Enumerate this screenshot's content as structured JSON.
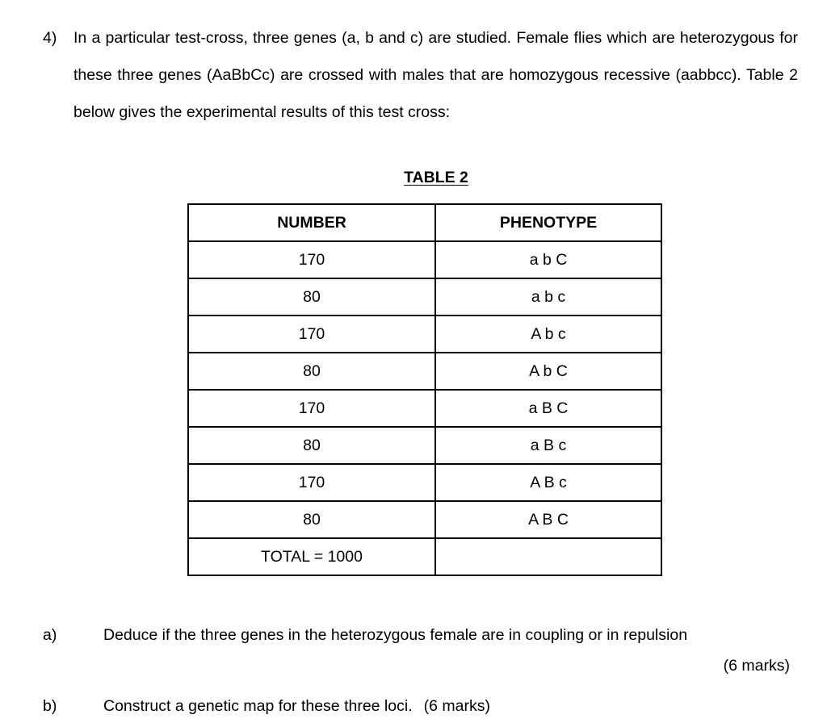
{
  "question": {
    "number": "4)",
    "text": "In a particular test-cross, three genes (a, b and c) are studied. Female flies which are heterozygous for these three genes (AaBbCc) are crossed with males that are homozygous recessive (aabbcc). Table 2 below gives the experimental results of this test cross:"
  },
  "table": {
    "title": "TABLE 2",
    "headers": [
      "NUMBER",
      "PHENOTYPE"
    ],
    "rows": [
      {
        "number": "170",
        "phenotype": "a b C"
      },
      {
        "number": "80",
        "phenotype": "a b c"
      },
      {
        "number": "170",
        "phenotype": "A b c"
      },
      {
        "number": "80",
        "phenotype": "A b C"
      },
      {
        "number": "170",
        "phenotype": "a B C"
      },
      {
        "number": "80",
        "phenotype": "a B c"
      },
      {
        "number": "170",
        "phenotype": "A B c"
      },
      {
        "number": "80",
        "phenotype": "A B C"
      }
    ],
    "total_label": "TOTAL = 1000"
  },
  "sub_questions": [
    {
      "marker": "a)",
      "text": "Deduce if the three genes in the heterozygous female are in coupling or in repulsion",
      "marks": "(6 marks)",
      "marks_position": "next-line-right"
    },
    {
      "marker": "b)",
      "text": "Construct a genetic map for these three loci.",
      "marks": "(6 marks)",
      "marks_position": "inline"
    }
  ],
  "colors": {
    "background": "#ffffff",
    "text": "#000000",
    "border": "#000000"
  }
}
